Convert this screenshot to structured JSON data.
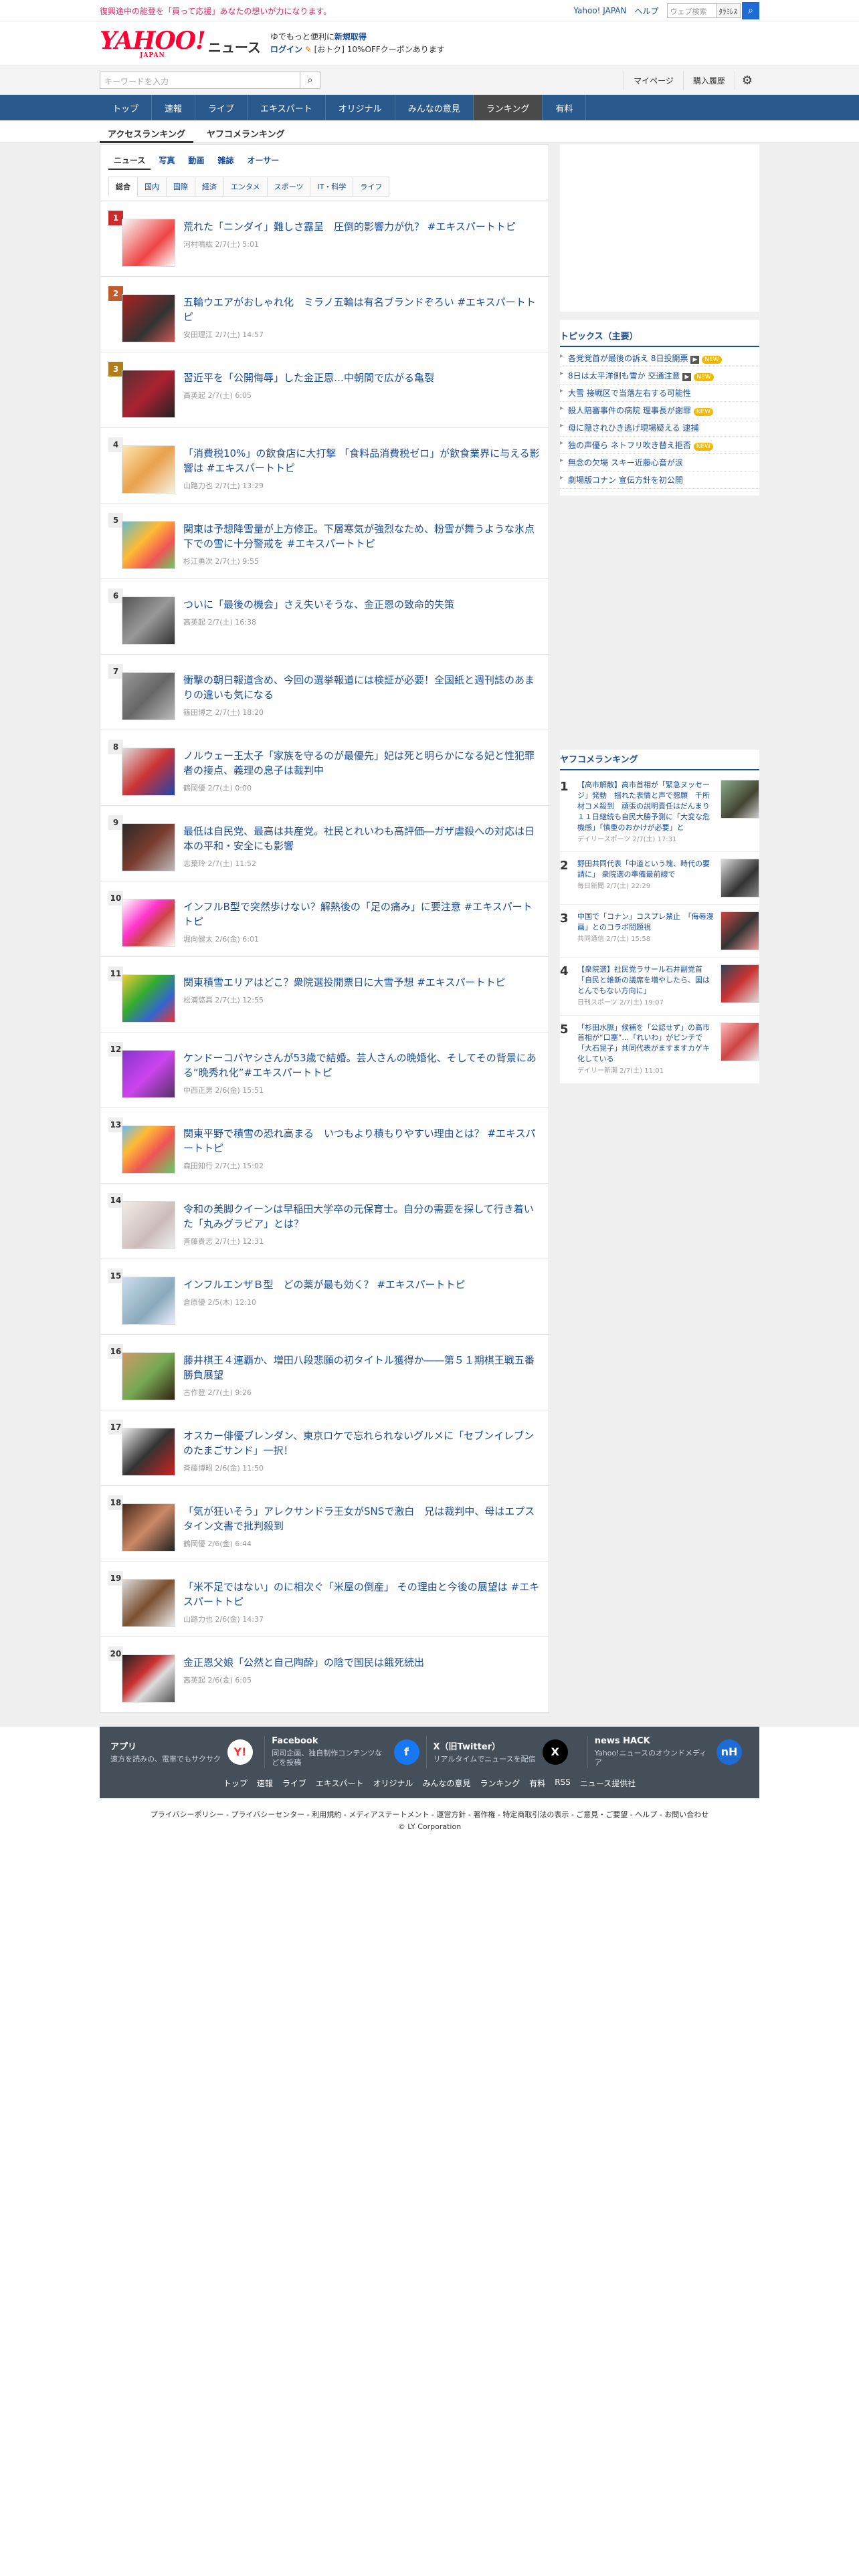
{
  "util": {
    "message": "復興途中の能登を「買って応援」あなたの想いが力になります。",
    "links": [
      "Yahoo! JAPAN",
      "ヘルプ"
    ],
    "search_placeholder": "ウェブ検索",
    "search_scope": "ﾀﾗﾐﾚｽ"
  },
  "masthead": {
    "logo": "YAHOO!",
    "logo_sub": "JAPAN",
    "section": "ニュース",
    "promo_line1": "ゆでもっと便利に",
    "promo_bold": "新規取得",
    "promo_login": "ログイン",
    "promo_coupon": "[おトク] 10%OFFクーポンあります"
  },
  "searchrow": {
    "placeholder": "キーワードを入力",
    "mypage": "マイページ",
    "history": "購入履歴"
  },
  "gnav": [
    "トップ",
    "速報",
    "ライブ",
    "エキスパート",
    "オリジナル",
    "みんなの意見",
    "ランキング",
    "有料"
  ],
  "gnav_active": "ランキング",
  "subnav": [
    "アクセスランキング",
    "ヤフコメランキング"
  ],
  "cat1": [
    "ニュース",
    "写真",
    "動画",
    "雑誌",
    "オーサー"
  ],
  "cat2": [
    "総合",
    "国内",
    "国際",
    "経済",
    "エンタメ",
    "スポーツ",
    "IT・科学",
    "ライフ"
  ],
  "ranking": [
    {
      "rank": "1",
      "title": "荒れた「ニンダイ」難しさ露呈　圧倒的影響力が仇？ #エキスパートトピ",
      "meta": "河村鳴紘 2/7(土) 5:01"
    },
    {
      "rank": "2",
      "title": "五輪ウエアがおしゃれ化　ミラノ五輪は有名ブランドぞろい #エキスパートトピ",
      "meta": "安田理江 2/7(土) 14:57"
    },
    {
      "rank": "3",
      "title": "習近平を「公開侮辱」した金正恩…中朝間で広がる亀裂",
      "meta": "高英起 2/7(土) 6:05"
    },
    {
      "rank": "4",
      "title": "「消費税10%」の飲食店に大打撃 「食料品消費税ゼロ」が飲食業界に与える影響は #エキスパートトピ",
      "meta": "山路力也 2/7(土) 13:29"
    },
    {
      "rank": "5",
      "title": "関東は予想降雪量が上方修正。下層寒気が強烈なため、粉雪が舞うような氷点下での雪に十分警戒を #エキスパートトピ",
      "meta": "杉江勇次 2/7(土) 9:55"
    },
    {
      "rank": "6",
      "title": "ついに「最後の機会」さえ失いそうな、金正恩の致命的失策",
      "meta": "高英起 2/7(土) 16:38"
    },
    {
      "rank": "7",
      "title": "衝撃の朝日報道含め、今回の選挙報道には検証が必要！全国紙と週刊誌のあまりの違いも気になる",
      "meta": "篠田博之 2/7(土) 18:20"
    },
    {
      "rank": "8",
      "title": "ノルウェー王太子「家族を守るのが最優先」妃は死と明らかになる妃と性犯罪者の接点、義理の息子は裁判中",
      "meta": "鶴岡優 2/7(土) 0:00"
    },
    {
      "rank": "9",
      "title": "最低は自民党、最高は共産党。社民とれいわも高評価―ガザ虐殺への対応は日本の平和・安全にも影響",
      "meta": "志葉玲 2/7(土) 11:52"
    },
    {
      "rank": "10",
      "title": "インフルB型で突然歩けない？解熱後の「足の痛み」に要注意 #エキスパートトピ",
      "meta": "堀向健太 2/6(金) 6:01"
    },
    {
      "rank": "11",
      "title": "関東積雪エリアはどこ？衆院選投開票日に大雪予想 #エキスパートトピ",
      "meta": "松浦悠真 2/7(土) 12:55"
    },
    {
      "rank": "12",
      "title": "ケンドーコバヤシさんが53歳で結婚。芸人さんの晩婚化、そしてその背景にある“晩秀れ化”#エキスパートトピ",
      "meta": "中西正男 2/6(金) 15:51"
    },
    {
      "rank": "13",
      "title": "関東平野で積雪の恐れ高まる　いつもより積もりやすい理由とは？ #エキスパートトピ",
      "meta": "森田知行 2/7(土) 15:02"
    },
    {
      "rank": "14",
      "title": "令和の美脚クイーンは早稲田大学卒の元保育士。自分の需要を探して行き着いた「丸みグラビア」とは？",
      "meta": "斉藤貴志 2/7(土) 12:31"
    },
    {
      "rank": "15",
      "title": "インフルエンザＢ型　どの薬が最も効く？ #エキスパートトピ",
      "meta": "倉原優 2/5(木) 12:10"
    },
    {
      "rank": "16",
      "title": "藤井棋王４連覇か、増田八段悲願の初タイトル獲得か――第５１期棋王戦五番勝負展望",
      "meta": "古作登 2/7(土) 9:26"
    },
    {
      "rank": "17",
      "title": "オスカー俳優ブレンダン、東京ロケで忘れられないグルメに「セブンイレブンのたまごサンド」一択！",
      "meta": "斉藤博昭 2/6(金) 11:50"
    },
    {
      "rank": "18",
      "title": "「気が狂いそう」アレクサンドラ王女がSNSで激白　兄は裁判中、母はエプスタイン文書で批判殺到",
      "meta": "鶴岡優 2/6(金) 6:44"
    },
    {
      "rank": "19",
      "title": "「米不足ではない」のに相次ぐ「米屋の倒産」 その理由と今後の展望は #エキスパートトピ",
      "meta": "山路力也 2/6(金) 14:37"
    },
    {
      "rank": "20",
      "title": "金正恩父娘「公然と自己陶酔」の陰で国民は餓死続出",
      "meta": "高英起 2/6(金) 6:05"
    }
  ],
  "topics": {
    "heading": "トピックス（主要）",
    "items": [
      {
        "text": "各党党首が最後の訴え 8日投開票",
        "badges": [
          "cam",
          "new"
        ]
      },
      {
        "text": "8日は太平洋側も雪か 交通注意",
        "badges": [
          "cam",
          "new"
        ]
      },
      {
        "text": "大雪 接戦区で当落左右する可能性",
        "badges": []
      },
      {
        "text": "殺人陪審事件の病院 理事長が謝罪",
        "badges": [
          "new"
        ]
      },
      {
        "text": "母に隠されひき逃げ現場疑える 逮捕",
        "badges": []
      },
      {
        "text": "独の声優ら ネトフリ吹き替え拒否",
        "badges": [
          "new"
        ]
      },
      {
        "text": "無念の欠場 スキー近藤心音が涙",
        "badges": []
      },
      {
        "text": "劇場版コナン 宣伝方針を初公開",
        "badges": []
      }
    ],
    "new_label": "NEW",
    "cam_label": "▶"
  },
  "yfk": {
    "heading": "ヤフコメランキング",
    "items": [
      {
        "n": "1",
        "text": "【高市解散】高市首相が「緊急ヌッセージ」発動　揺れた表情と声で懇願　千所材コメ殺到　頑張の説明責任はだんまり１１日継続も自民大勝予測に「大変な危機感」「慎重のおかけが必要」と",
        "src": "デイリースポーツ 2/7(土) 17:31"
      },
      {
        "n": "2",
        "text": "野田共同代表「中道という塊、時代の要請に」 衆院選の準備最前線で",
        "src": "毎日新聞 2/7(土) 22:29"
      },
      {
        "n": "3",
        "text": "中国で「コナン」コスプレ禁止　「侮辱漫画」とのコラボ問題視",
        "src": "共同通信 2/7(土) 15:58"
      },
      {
        "n": "4",
        "text": "【衆院選】社民党ラサール石井副党首「自民と維新の議席を増やしたら、国はとんでもない方向に」",
        "src": "日刊スポーツ 2/7(土) 19:07"
      },
      {
        "n": "5",
        "text": "「杉田水脈」候補を「公認せず」の高市首相が“口塞”…「れいわ」がピンチで「大石晃子」共同代表がますますカゲキ化している",
        "src": "デイリー新潮 2/7(土) 11:01"
      }
    ]
  },
  "footer": {
    "cards": [
      {
        "h": "アプリ",
        "d": "速方を読みの、電車でもサクサク",
        "icon": "yahoo-app-icon"
      },
      {
        "h": "Facebook",
        "d": "同司企画、独自制作コンテンツなどを投稿",
        "icon": "facebook-icon"
      },
      {
        "h": "X（旧Twitter）",
        "d": "リアルタイムでニュースを配信",
        "icon": "x-icon"
      },
      {
        "h": "news HACK",
        "d": "Yahoo!ニュースのオウンドメディア",
        "icon": "newshack-icon"
      }
    ],
    "links": [
      "トップ",
      "速報",
      "ライブ",
      "エキスパート",
      "オリジナル",
      "みんなの意見",
      "ランキング",
      "有料",
      "RSS",
      "ニュース提供社"
    ],
    "legal": "プライバシーポリシー - プライバシーセンター - 利用規約 - メディアステートメント - 運営方針 - 著作権 - 特定商取引法の表示 - ご意見・ご要望 - ヘルプ - お問い合わせ",
    "copyright": "© LY Corporation"
  }
}
